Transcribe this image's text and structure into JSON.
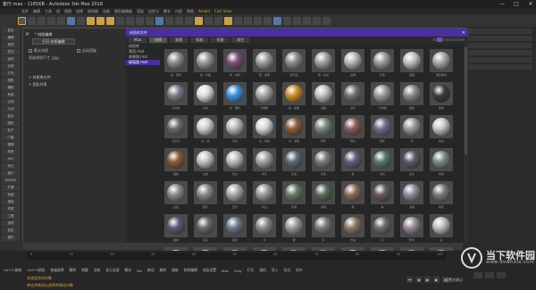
{
  "window": {
    "title": "客厅.max - 1165KB - Autodesk 3ds Max 2018",
    "controls": [
      "—",
      "□",
      "✕"
    ]
  },
  "colors": {
    "accent_purple": "#4a2fa0",
    "accent_orange": "#e0a63c",
    "selection_blue": "#3b3b5e"
  },
  "browser": {
    "panel_name": "* 材质编辑",
    "open_button": "打开 材质编辑",
    "checkbox_1": "默认材质",
    "checkbox_2": "自动渲染",
    "preview_label": "渲染球型尺寸",
    "preview_value": "200",
    "nav_items": [
      "> 材质库文件",
      "> 团队共享"
    ],
    "header_title": "材质库文件",
    "tabs": [
      "Max",
      "材质",
      "贴图",
      "标准",
      "光源",
      "其它"
    ],
    "active_tab_index": 1,
    "slider_value": 0.18,
    "library_list": [
      "材质库",
      "常用.mat",
      "效果图.mat",
      "玻璃类.mat"
    ],
    "active_library_index": 3
  },
  "materials": [
    {
      "color": "#8a8a8a",
      "cap": "铁 - 磨砂"
    },
    {
      "color": "#9a9a9a",
      "cap": "铁 - 光面"
    },
    {
      "color": "#7a4f7a",
      "cap": "紫 - 布料"
    },
    {
      "color": "#9c9c9c",
      "cap": "银 - 金属"
    },
    {
      "color": "#8c8c8c",
      "cap": "亚光铝"
    },
    {
      "color": "#a0a0a0",
      "cap": "钢 - 拉丝"
    },
    {
      "color": "#b5b5b5",
      "cap": "白钢"
    },
    {
      "color": "#9a9a9a",
      "cap": "灰漆"
    },
    {
      "color": "#c0c0c0",
      "cap": "亮银"
    },
    {
      "color": "#a8a8a8",
      "cap": "磨砂玻璃"
    },
    {
      "color": "#7a7a8a",
      "cap": "灰蓝漆"
    },
    {
      "color": "#dcdcdc",
      "cap": "白漆"
    },
    {
      "color": "#3c8fd8",
      "cap": "蓝 - 塑料"
    },
    {
      "color": "#a8a8a8",
      "cap": "灰塑料"
    },
    {
      "color": "#c98a2c",
      "cap": "金 - 金属"
    },
    {
      "color": "#c0c0c0",
      "cap": "亮铬"
    },
    {
      "color": "#707070",
      "cap": "深灰"
    },
    {
      "color": "#9a9a9a",
      "cap": "不锈钢"
    },
    {
      "color": "#8a8a8a",
      "cap": "铝板"
    },
    {
      "color": "#3a3a3a",
      "cap": "黑漆"
    },
    {
      "color": "#6a6a6a",
      "cap": "深灰漆"
    },
    {
      "color": "#cfcfcf",
      "cap": "白 - 瓷"
    },
    {
      "color": "#b8b8b8",
      "cap": "浅灰"
    },
    {
      "color": "#d8d8d8",
      "cap": "白 - 乳胶"
    },
    {
      "color": "#8c5c3c",
      "cap": "木 - 深色"
    },
    {
      "color": "#7a8a7a",
      "cap": "绿灰"
    },
    {
      "color": "#8a5a5a",
      "cap": "砖红"
    },
    {
      "color": "#7a6a8a",
      "cap": "紫灰"
    },
    {
      "color": "#9a9a9a",
      "cap": "灰"
    },
    {
      "color": "#c8c8c8",
      "cap": "亮白"
    },
    {
      "color": "#8a5a3c",
      "cap": "橙褐"
    },
    {
      "color": "#c4c4c4",
      "cap": "白色"
    },
    {
      "color": "#bdbdbd",
      "cap": "米白"
    },
    {
      "color": "#a3a3a3",
      "cap": "中灰"
    },
    {
      "color": "#5a6a7a",
      "cap": "灰蓝"
    },
    {
      "color": "#7a7a7a",
      "cap": "灰色"
    },
    {
      "color": "#6a5a7a",
      "cap": "紫"
    },
    {
      "color": "#5a7a6a",
      "cap": "青灰"
    },
    {
      "color": "#5a5a6a",
      "cap": "蓝灰"
    },
    {
      "color": "#7a8a8a",
      "cap": "青色"
    },
    {
      "color": "#8a8a8a",
      "cap": "拉丝"
    },
    {
      "color": "#8a8a8a",
      "cap": "银灰"
    },
    {
      "color": "#aaaaaa",
      "cap": "亚光"
    },
    {
      "color": "#9a9a9a",
      "cap": "灰白"
    },
    {
      "color": "#6a7a6a",
      "cap": "墨绿"
    },
    {
      "color": "#5a6a5a",
      "cap": "深绿"
    },
    {
      "color": "#8a6a5a",
      "cap": "棕"
    },
    {
      "color": "#6a5a5a",
      "cap": "褐"
    },
    {
      "color": "#8a8a9a",
      "cap": "浅紫"
    },
    {
      "color": "#7a7a7a",
      "cap": "铁灰"
    },
    {
      "color": "#5a5a7a",
      "cap": "藏青"
    },
    {
      "color": "#6a6a6a",
      "cap": "深灰"
    },
    {
      "color": "#6a7a8a",
      "cap": "钢蓝"
    },
    {
      "color": "#8a8a8a",
      "cap": "灰"
    },
    {
      "color": "#9a9a9a",
      "cap": "银"
    },
    {
      "color": "#7a7a7a",
      "cap": "灰"
    },
    {
      "color": "#8a7a6a",
      "cap": "卡其"
    },
    {
      "color": "#6a6a6a",
      "cap": "灰"
    },
    {
      "color": "#9a8a9a",
      "cap": "粉灰"
    },
    {
      "color": "#bdbdbd",
      "cap": "白"
    },
    {
      "color": "#c8c8c8",
      "cap": "MAT"
    },
    {
      "color": "#cfcfcf",
      "cap": "白漆"
    },
    {
      "color": "#a8a8a8",
      "cap": "灰漆"
    },
    {
      "color": "#c0c0c0",
      "cap": "亮白"
    },
    {
      "color": "#9a9a9a",
      "cap": "灰色"
    },
    {
      "color": "#8a8a8a",
      "cap": "磨砂"
    },
    {
      "color": "#d0d0d0",
      "cap": "白"
    },
    {
      "color": "#bbbbbb",
      "cap": "MAT"
    },
    {
      "color": "#9a9a9a",
      "cap": "灰"
    },
    {
      "color": "#b0b0b0",
      "cap": "亮灰"
    }
  ],
  "command_panel": [
    "显示",
    "编辑",
    "修改",
    "层次",
    "运动",
    "实用",
    "灯光",
    "相机",
    "辅助",
    "系统",
    "空间",
    "几何",
    "复合",
    "图形",
    "粒子",
    "门窗",
    "楼梯",
    "样条",
    "AEC",
    "动力",
    "面片",
    "NURBS",
    "扩展",
    "动画",
    "渲染",
    "材质",
    "工具",
    "选项",
    "自定",
    "插件"
  ],
  "menubar": [
    "文件",
    "编辑",
    "工具",
    "组",
    "视图",
    "创建",
    "修改器",
    "动画",
    "图形编辑器",
    "渲染",
    "自定义",
    "脚本",
    "内容",
    "帮助",
    "Arnold",
    "Civil View"
  ],
  "timeline_ticks": [
    "0",
    "10",
    "20",
    "30",
    "40",
    "50",
    "60",
    "70",
    "80",
    "90",
    "100"
  ],
  "bottom_tools": [
    "Ctrl+C复制",
    "Ctrl+V粘贴",
    "快速选择",
    "删除",
    "隐藏",
    "冻结",
    "显示全部",
    "解冻",
    "Sel",
    "移动",
    "旋转",
    "缩放",
    "材质编辑",
    "渲染设置",
    "Max",
    "Vray",
    "灯光",
    "相机",
    "导入",
    "导出",
    "合并"
  ],
  "status_lines": [
    "未选定任何对象",
    "单击并拖动以选择并移动对象"
  ],
  "set_key": "设置关键点",
  "watermark": {
    "cn": "当下软件园",
    "en": "www.downxia.com"
  }
}
